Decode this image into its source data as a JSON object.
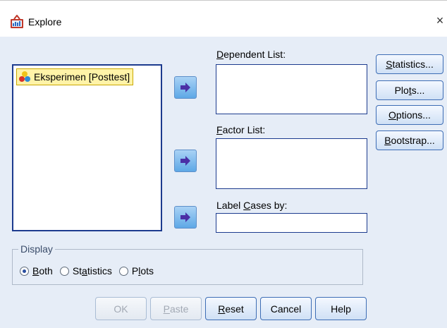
{
  "window": {
    "title": "Explore",
    "close_glyph": "×"
  },
  "source_list": {
    "items": [
      {
        "label": "Eksperimen [Posttest]",
        "icon": "scale-variable-icon"
      }
    ]
  },
  "dependent": {
    "label_mn": "D",
    "label_rest": "ependent List:"
  },
  "factor": {
    "label_mn": "F",
    "label_rest": "actor List:"
  },
  "label_cases": {
    "label_pre": "Label ",
    "label_mn": "C",
    "label_rest": "ases by:"
  },
  "side_buttons": {
    "statistics": {
      "mn": "S",
      "rest": "tatistics..."
    },
    "plots": {
      "pre": "Plo",
      "mn": "t",
      "rest": "s..."
    },
    "options": {
      "mn": "O",
      "rest": "ptions..."
    },
    "bootstrap": {
      "mn": "B",
      "rest": "ootstrap..."
    }
  },
  "display": {
    "legend": "Display",
    "options": [
      {
        "pre": "",
        "mn": "B",
        "rest": "oth",
        "selected": true
      },
      {
        "pre": "St",
        "mn": "a",
        "rest": "tistics",
        "selected": false
      },
      {
        "pre": "P",
        "mn": "l",
        "rest": "ots",
        "selected": false
      }
    ]
  },
  "bottom_buttons": {
    "ok": {
      "label": "OK",
      "enabled": false
    },
    "paste": {
      "mn": "P",
      "rest": "aste",
      "enabled": false
    },
    "reset": {
      "mn": "R",
      "rest": "eset",
      "enabled": true
    },
    "cancel": {
      "label": "Cancel",
      "enabled": true
    },
    "help": {
      "label": "Help",
      "enabled": true
    }
  },
  "colors": {
    "accent_border": "#1c3b8e",
    "selection": "#fff3a8",
    "arrow_button": "#5ea8e6"
  }
}
